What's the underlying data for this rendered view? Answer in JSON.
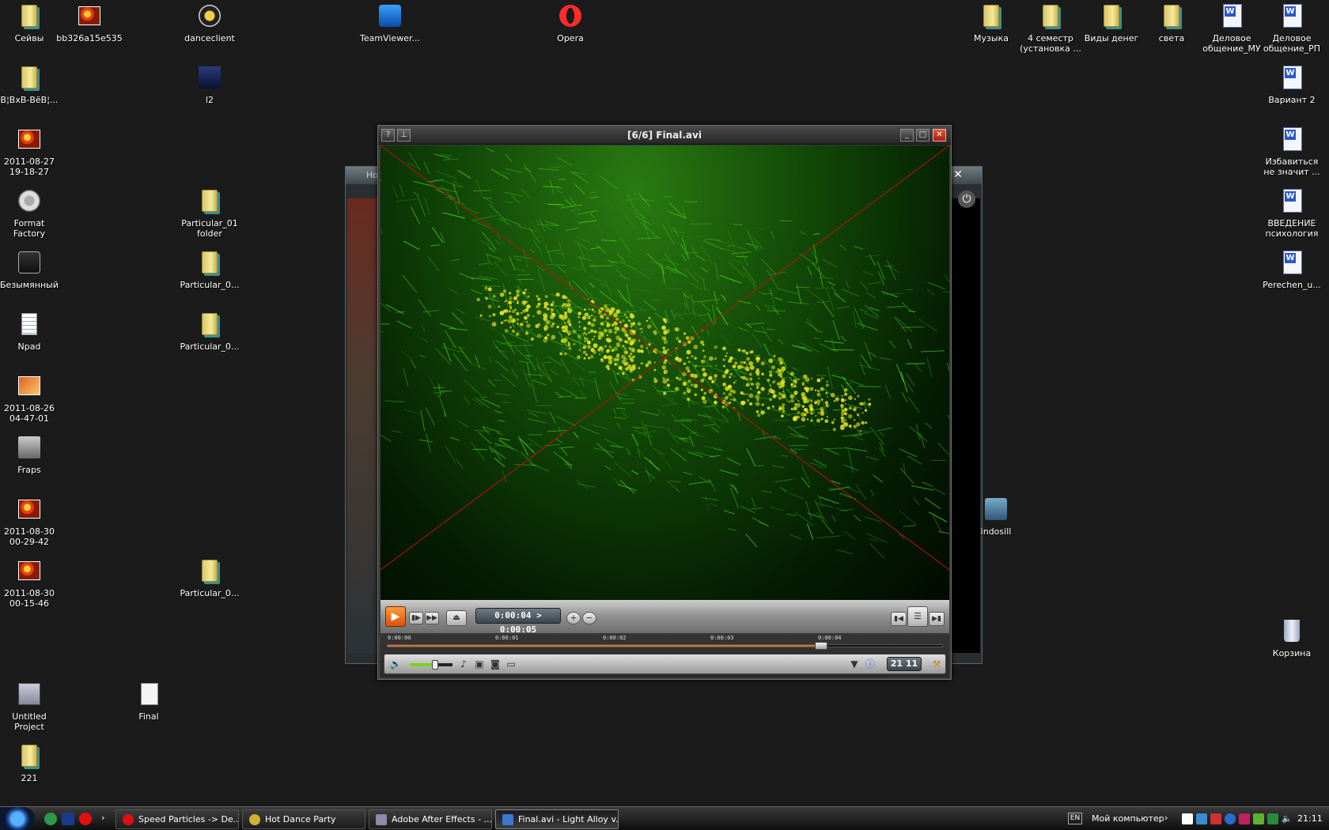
{
  "desktop": {
    "icons_left": [
      {
        "label": "Сейвы",
        "icon": "folder-icon"
      },
      {
        "label": "bb326a15e535",
        "icon": "image-icon"
      },
      {
        "label": "danceclient",
        "icon": "app-icon"
      },
      {
        "label": "TeamViewer...",
        "icon": "teamviewer-icon"
      },
      {
        "label": "Opera",
        "icon": "opera-icon"
      },
      {
        "label": "В¦ВхВ-ВёВ¦...",
        "icon": "folder-icon"
      },
      {
        "label": "l2",
        "icon": "app-icon"
      },
      {
        "label": "2011-08-27\n19-18-27",
        "icon": "image-icon"
      },
      {
        "label": "Format\nFactory",
        "icon": "app-icon"
      },
      {
        "label": "Particular_01\nfolder",
        "icon": "folder-icon"
      },
      {
        "label": "Безымянный",
        "icon": "file-icon"
      },
      {
        "label": "Particular_0...",
        "icon": "folder-icon"
      },
      {
        "label": "Npad",
        "icon": "notepad-icon"
      },
      {
        "label": "Particular_0...",
        "icon": "folder-icon"
      },
      {
        "label": "2011-08-26\n04-47-01",
        "icon": "image-icon"
      },
      {
        "label": "Fraps",
        "icon": "app-icon"
      },
      {
        "label": "2011-08-30\n00-29-42",
        "icon": "image-icon"
      },
      {
        "label": "2011-08-30\n00-15-46",
        "icon": "image-icon"
      },
      {
        "label": "Particular_0...",
        "icon": "folder-icon"
      },
      {
        "label": "Untitled\nProject",
        "icon": "ae-project-icon"
      },
      {
        "label": "Final",
        "icon": "avi-file-icon"
      },
      {
        "label": "221",
        "icon": "folder-icon"
      }
    ],
    "icons_right": [
      {
        "label": "Музыка",
        "icon": "folder-icon"
      },
      {
        "label": "4 семестр\n(установка ...",
        "icon": "folder-icon"
      },
      {
        "label": "Виды денег",
        "icon": "folder-icon"
      },
      {
        "label": "света",
        "icon": "folder-icon"
      },
      {
        "label": "Деловое\nобщение_МУ",
        "icon": "word-doc-icon"
      },
      {
        "label": "Деловое\nобщение_РП",
        "icon": "word-doc-icon"
      },
      {
        "label": "Вариант 2",
        "icon": "word-doc-icon"
      },
      {
        "label": "Избавиться\nне значит ...",
        "icon": "word-doc-icon"
      },
      {
        "label": "ВВЕДЕНИЕ\nпсихология",
        "icon": "word-doc-icon"
      },
      {
        "label": "Perechen_u...",
        "icon": "word-doc-icon"
      },
      {
        "label": "indosill",
        "icon": "app-icon"
      },
      {
        "label": "Корзина",
        "icon": "recycle-bin-icon"
      }
    ]
  },
  "background_window": {
    "title": "Ho"
  },
  "player": {
    "title": "[6/6] Final.avi",
    "help_label": "?",
    "pin_label": "⊥",
    "time_display": "0:00:04 > 0:00:05",
    "clock": "21 11",
    "timeline_ticks": [
      "0:00:00",
      "0:00:01",
      "0:00:02",
      "0:00:03",
      "0:00:04"
    ],
    "progress": 0.78,
    "volume": 0.6
  },
  "taskbar": {
    "tasks": [
      {
        "label": "Speed Particles -> De...",
        "icon": "opera-icon"
      },
      {
        "label": "Hot Dance Party",
        "icon": "dance-icon"
      },
      {
        "label": "Adobe After Effects - ...",
        "icon": "ae-icon"
      },
      {
        "label": "Final.avi - Light Alloy v...",
        "icon": "light-alloy-icon"
      }
    ],
    "language": "EN",
    "my_computer": "Мой компьютер",
    "time": "21:11"
  },
  "colors": {
    "accent_orange": "#d8500a",
    "video_green": "#2a7a12",
    "particle_yellow": "#e8e020"
  }
}
